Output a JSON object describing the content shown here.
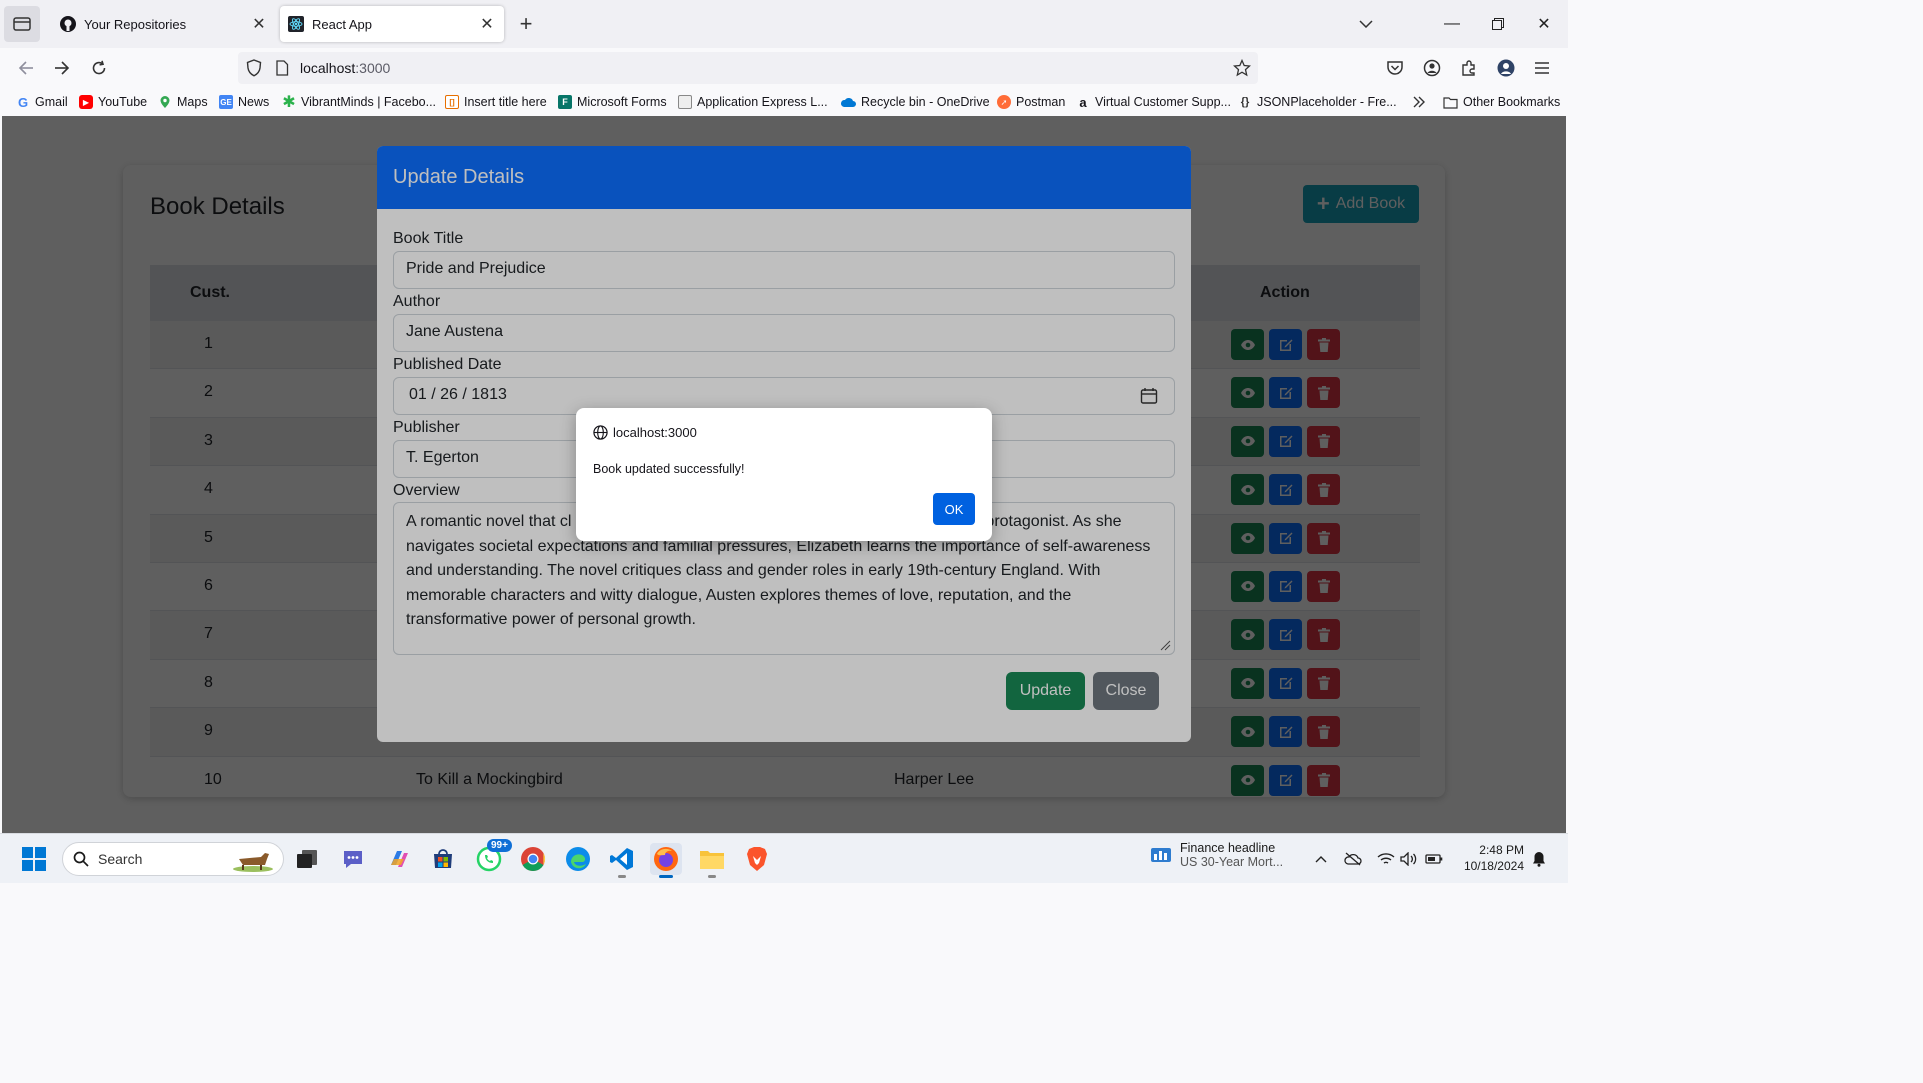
{
  "browser": {
    "tabs": [
      {
        "title": "Your Repositories",
        "active": false
      },
      {
        "title": "React App",
        "active": true
      }
    ],
    "url": {
      "host": "localhost",
      "port": ":3000"
    },
    "bookmarks": [
      {
        "label": "Gmail"
      },
      {
        "label": "YouTube"
      },
      {
        "label": "Maps"
      },
      {
        "label": "News"
      },
      {
        "label": "VibrantMinds | Facebo..."
      },
      {
        "label": "Insert title here"
      },
      {
        "label": "Microsoft Forms"
      },
      {
        "label": "Application Express L..."
      },
      {
        "label": "Recycle bin - OneDrive"
      },
      {
        "label": "Postman"
      },
      {
        "label": "Virtual Customer Supp..."
      },
      {
        "label": "JSONPlaceholder - Fre..."
      }
    ],
    "other_bookmarks": "Other Bookmarks"
  },
  "page": {
    "title": "Book Details",
    "add_button": "Add Book",
    "table": {
      "headers": {
        "cust": "Cust.",
        "action": "Action"
      },
      "rows": [
        "1",
        "2",
        "3",
        "4",
        "5",
        "6",
        "7",
        "8",
        "9",
        "10"
      ],
      "partial_row": {
        "title": "To Kill a Mockingbird",
        "author": "Harper Lee"
      }
    }
  },
  "modal": {
    "title": "Update Details",
    "labels": {
      "title": "Book Title",
      "author": "Author",
      "date": "Published Date",
      "publisher": "Publisher",
      "overview": "Overview"
    },
    "values": {
      "title": "Pride and Prejudice",
      "author": "Jane Austena",
      "date": "01 / 26 / 1813",
      "publisher": "T. Egerton",
      "overview_lines": [
        "A romantic novel that cl",
        "protagonist. As she",
        "navigates societal expectations and familial pressures, Elizabeth learns the importance of self-awareness",
        "and understanding. The novel critiques class and gender roles in early 19th-century England. With",
        "memorable characters and witty dialogue, Austen explores themes of love, reputation, and the",
        "transformative power of personal growth."
      ]
    },
    "buttons": {
      "update": "Update",
      "close": "Close"
    }
  },
  "alert": {
    "origin": "localhost:3000",
    "message": "Book updated successfully!",
    "ok": "OK"
  },
  "taskbar": {
    "search": "Search",
    "whatsapp_badge": "99+",
    "news_title": "Finance headline",
    "news_sub": "US 30-Year Mort...",
    "time": "2:48 PM",
    "date": "10/18/2024"
  },
  "colors": {
    "primary": "#0d6efd",
    "success": "#198754",
    "danger": "#dc3545",
    "info": "#17a2b8",
    "secondary": "#6c757d",
    "alert_ok": "#0061e0"
  }
}
